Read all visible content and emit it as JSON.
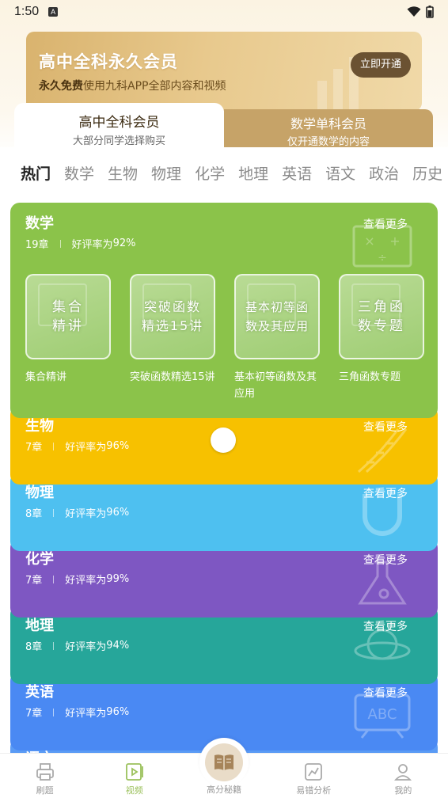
{
  "status_bar": {
    "time": "1:50",
    "notif_letter": "A"
  },
  "banner": {
    "title": "高中全科永久会员",
    "sub_bold": "永久免费",
    "sub_rest": "使用九科APP全部内容和视频",
    "button": "立即开通"
  },
  "member_tabs": {
    "active": {
      "title": "高中全科会员",
      "sub": "大部分同学选择购买"
    },
    "inactive": {
      "title": "数学单科会员",
      "sub": "仅开通数学的内容"
    }
  },
  "subject_tabs": [
    "热门",
    "数学",
    "生物",
    "物理",
    "化学",
    "地理",
    "英语",
    "语文",
    "政治",
    "历史"
  ],
  "more_label": "查看更多",
  "rating_prefix": "好评率为",
  "cards": [
    {
      "name": "数学",
      "chapters": "19章",
      "rating": "92%",
      "color": "#8bc34a"
    },
    {
      "name": "生物",
      "chapters": "7章",
      "rating": "96%",
      "color": "#f7c100"
    },
    {
      "name": "物理",
      "chapters": "8章",
      "rating": "96%",
      "color": "#4ec0f0"
    },
    {
      "name": "化学",
      "chapters": "7章",
      "rating": "99%",
      "color": "#7e57c2"
    },
    {
      "name": "地理",
      "chapters": "8章",
      "rating": "94%",
      "color": "#26a69a"
    },
    {
      "name": "英语",
      "chapters": "7章",
      "rating": "96%",
      "color": "#4a89f3"
    },
    {
      "name": "语文",
      "chapters": "",
      "rating": "",
      "color": "#5a9bf5"
    }
  ],
  "math_courses": [
    {
      "thumb": "集合\n精讲",
      "title": "集合精讲"
    },
    {
      "thumb": "突破函数\n精选15讲",
      "title": "突破函数精选15讲"
    },
    {
      "thumb": "基本初等函\n数及其应用",
      "title": "基本初等函数及其应用"
    },
    {
      "thumb": "三角函\n数专题",
      "title": "三角函数专题"
    }
  ],
  "bottom_nav": [
    {
      "label": "刷题",
      "icon": "printer-icon"
    },
    {
      "label": "视频",
      "icon": "video-icon",
      "active": true
    },
    {
      "label": "高分秘籍",
      "icon": "book-icon"
    },
    {
      "label": "易错分析",
      "icon": "chart-icon"
    },
    {
      "label": "我的",
      "icon": "user-icon"
    }
  ]
}
